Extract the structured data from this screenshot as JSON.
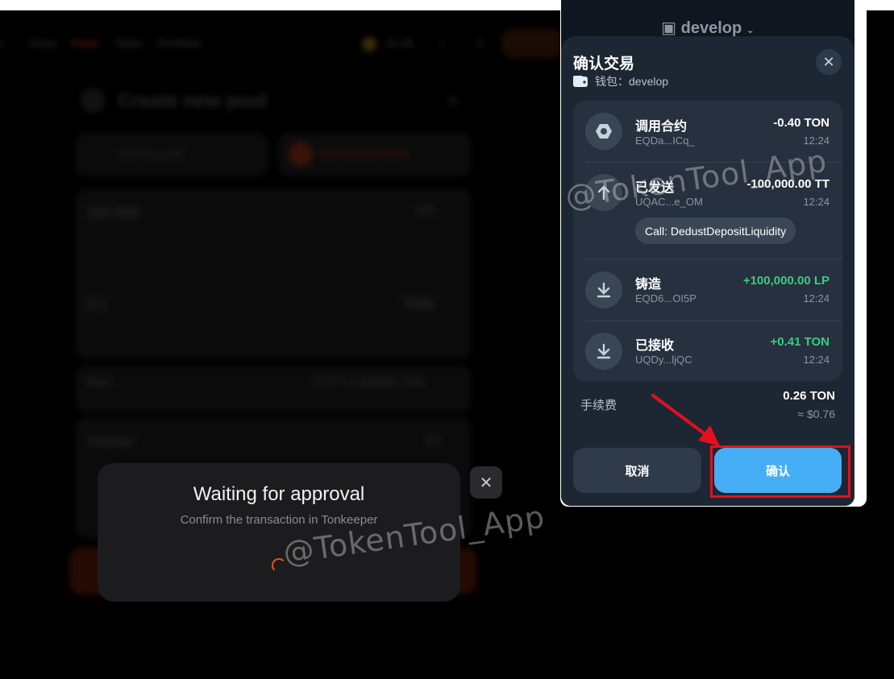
{
  "background_app": {
    "nav_items": [
      "Swap",
      "Pools",
      "Stake",
      "Portfolio"
    ],
    "balance": "$1.65",
    "page_title": "Create new pool",
    "step1": "Create a pair",
    "step2": "Deposit liquidity",
    "token_a": {
      "amount": "100 000",
      "symbol": "TT"
    },
    "token_b": {
      "amount": "0.1",
      "symbol": "TON"
    },
    "rate_label": "Rate",
    "rate_value": "1 TT = 0.000001 TON",
    "slippage_label": "Slippage",
    "slippage_value": "1%"
  },
  "waiting_dialog": {
    "title": "Waiting for approval",
    "subtitle": "Confirm the transaction in Tonkeeper"
  },
  "wallet_popup": {
    "wallet_name_top": "develop",
    "title": "确认交易",
    "wallet_label": "钱包：",
    "wallet_name": "develop",
    "actions": [
      {
        "icon": "contract-icon",
        "title": "调用合约",
        "address": "EQDa...ICq_",
        "amount": "-0.40 TON",
        "time": "12:24",
        "positive": false
      },
      {
        "icon": "arrow-up-icon",
        "title": "已发送",
        "address": "UQAC...e_OM",
        "amount": "-100,000.00 TT",
        "time": "12:24",
        "positive": false,
        "chip": "Call: DedustDepositLiquidity"
      },
      {
        "icon": "arrow-down-icon",
        "title": "铸造",
        "address": "EQD6...OI5P",
        "amount": "+100,000.00 LP",
        "time": "12:24",
        "positive": true
      },
      {
        "icon": "arrow-down-icon",
        "title": "已接收",
        "address": "UQDy...ljQC",
        "amount": "+0.41 TON",
        "time": "12:24",
        "positive": true
      }
    ],
    "fee_label": "手续费",
    "fee_amount": "0.26 TON",
    "fee_fiat": "≈ $0.76",
    "cancel_label": "取消",
    "confirm_label": "确认"
  },
  "watermark": "@TokenTool_App",
  "colors": {
    "accent": "#45aef5",
    "positive": "#39cc83",
    "highlight": "#e3101e",
    "brand": "#e8502a"
  }
}
